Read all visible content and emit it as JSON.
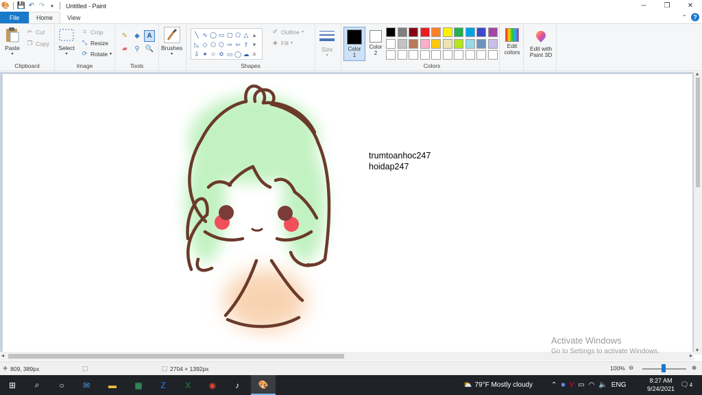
{
  "window": {
    "title": "Untitled - Paint",
    "controls": {
      "minimize": "─",
      "restore": "❐",
      "close": "✕"
    }
  },
  "tabs": {
    "file": "File",
    "home": "Home",
    "view": "View"
  },
  "ribbon": {
    "clipboard": {
      "label": "Clipboard",
      "paste": "Paste",
      "cut": "Cut",
      "copy": "Copy"
    },
    "image": {
      "label": "Image",
      "select": "Select",
      "crop": "Crop",
      "resize": "Resize",
      "rotate": "Rotate"
    },
    "tools": {
      "label": "Tools"
    },
    "brushes": {
      "label": "Brushes"
    },
    "shapes": {
      "label": "Shapes",
      "outline": "Outline",
      "fill": "Fill"
    },
    "size": {
      "label": "Size"
    },
    "colors": {
      "label": "Colors",
      "color1": {
        "label": "Color",
        "num": "1",
        "value": "#000000"
      },
      "color2": {
        "label": "Color",
        "num": "2",
        "value": "#ffffff"
      },
      "edit": "Edit colors",
      "palette": [
        "#000000",
        "#7f7f7f",
        "#880015",
        "#ed1c24",
        "#ff7f27",
        "#fff200",
        "#22b14c",
        "#00a2e8",
        "#3f48cc",
        "#a349a4",
        "#ffffff",
        "#c3c3c3",
        "#b97a57",
        "#ffaec9",
        "#ffc90e",
        "#efe4b0",
        "#b5e61d",
        "#99d9ea",
        "#7092be",
        "#c8bfe7",
        "#ffffff",
        "#ffffff",
        "#ffffff",
        "#ffffff",
        "#ffffff",
        "#ffffff",
        "#ffffff",
        "#ffffff",
        "#ffffff",
        "#ffffff"
      ]
    },
    "paint3d": "Edit with Paint 3D"
  },
  "canvas": {
    "text_line1": "trumtoanhoc247",
    "text_line2": "hoidap247",
    "drawing": {
      "outline_color": "#6b3a2a",
      "hair_color": "#b8f0b8",
      "blush_color": "#f0505a",
      "eye_color": "#7a3c38",
      "body_color": "#f7c9a0"
    }
  },
  "watermark": {
    "line1": "Activate Windows",
    "line2": "Go to Settings to activate Windows."
  },
  "status": {
    "cursor_pos": "809, 389px",
    "canvas_size": "2704 × 1392px",
    "zoom": "100%"
  },
  "taskbar": {
    "weather": "79°F  Mostly cloudy",
    "lang": "ENG",
    "time": "8:27 AM",
    "date": "9/24/2021",
    "notif_count": "4"
  }
}
